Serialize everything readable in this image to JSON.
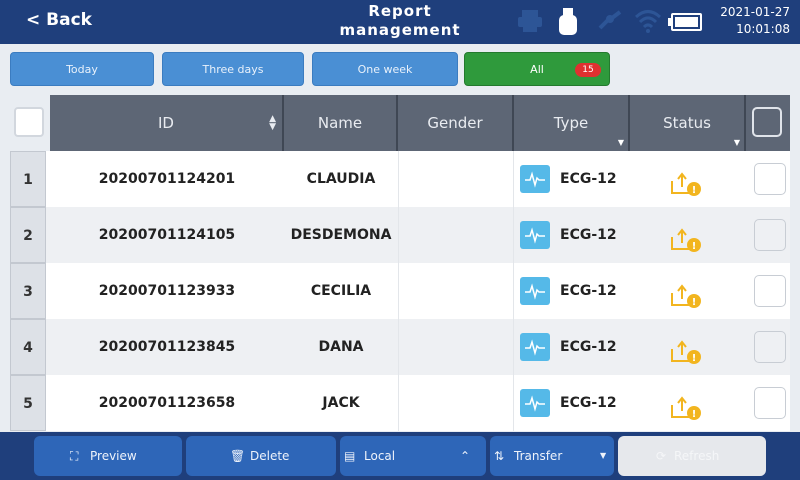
{
  "header": {
    "back_label": "< Back",
    "title_line1": "Report",
    "title_line2": "management",
    "date": "2021-01-27",
    "time": "10:01:08"
  },
  "status_icons": [
    "printer-icon",
    "usb-icon",
    "link-icon",
    "wifi-icon",
    "battery-icon"
  ],
  "filters": [
    {
      "label": "Today",
      "active": false
    },
    {
      "label": "Three days",
      "active": false
    },
    {
      "label": "One week",
      "active": false
    },
    {
      "label": "All",
      "active": true,
      "badge": "15"
    }
  ],
  "table": {
    "columns": [
      "ID",
      "Name",
      "Gender",
      "Type",
      "Status"
    ],
    "rows": [
      {
        "num": "1",
        "id": "20200701124201",
        "name": "CLAUDIA",
        "gender": "",
        "type": "ECG-12"
      },
      {
        "num": "2",
        "id": "20200701124105",
        "name": "DESDEMONA",
        "gender": "",
        "type": "ECG-12"
      },
      {
        "num": "3",
        "id": "20200701123933",
        "name": "CECILIA",
        "gender": "",
        "type": "ECG-12"
      },
      {
        "num": "4",
        "id": "20200701123845",
        "name": "DANA",
        "gender": "",
        "type": "ECG-12"
      },
      {
        "num": "5",
        "id": "20200701123658",
        "name": "JACK",
        "gender": "",
        "type": "ECG-12"
      }
    ]
  },
  "toolbar": {
    "preview_label": "Preview",
    "delete_label": "Delete",
    "local_label": "Local",
    "transfer_label": "Transfer",
    "refresh_label": "Refresh"
  },
  "colors": {
    "header_bg": "#1f3f7c",
    "filter_blue": "#4a8fd4",
    "filter_active": "#2f9a3c",
    "table_header": "#5d6675",
    "status_icon": "#f2b51f",
    "type_icon": "#55b9e8"
  }
}
